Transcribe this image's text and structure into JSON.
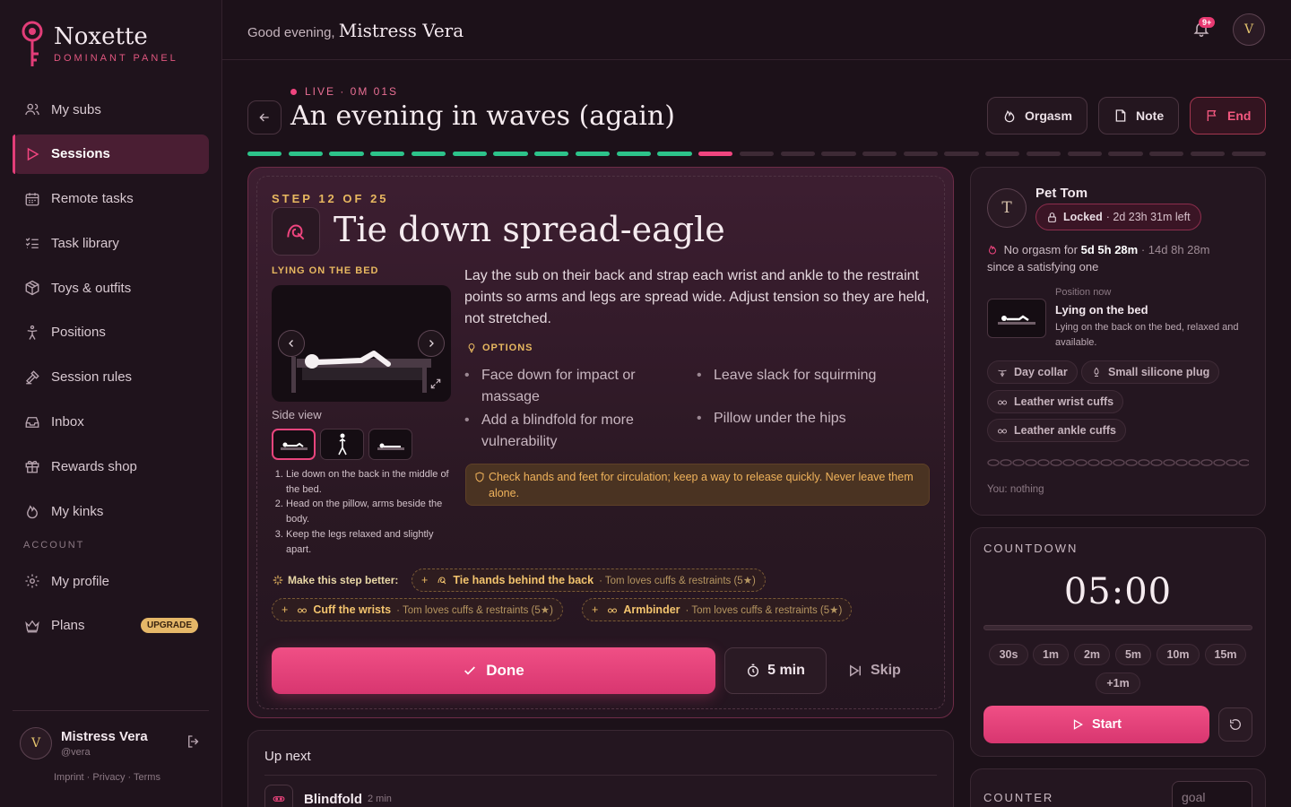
{
  "brand": {
    "name": "Noxette",
    "subtitle": "DOMINANT PANEL",
    "accent": "#e23d78"
  },
  "sidebar": {
    "items": [
      {
        "label": "My subs",
        "icon": "users-icon",
        "active": false
      },
      {
        "label": "Sessions",
        "icon": "play-icon",
        "active": true
      },
      {
        "label": "Remote tasks",
        "icon": "calendar-icon",
        "active": false
      },
      {
        "label": "Task library",
        "icon": "checklist-icon",
        "active": false
      },
      {
        "label": "Toys & outfits",
        "icon": "box-icon",
        "active": false
      },
      {
        "label": "Positions",
        "icon": "figure-icon",
        "active": false
      },
      {
        "label": "Session rules",
        "icon": "gavel-icon",
        "active": false
      },
      {
        "label": "Inbox",
        "icon": "inbox-icon",
        "active": false
      },
      {
        "label": "Rewards shop",
        "icon": "gift-icon",
        "active": false
      },
      {
        "label": "My kinks",
        "icon": "flame-icon",
        "active": false
      }
    ],
    "account_label": "ACCOUNT",
    "account_items": [
      {
        "label": "My profile",
        "icon": "gear-icon"
      },
      {
        "label": "Plans",
        "icon": "crown-icon",
        "badge": "UPGRADE"
      }
    ],
    "user": {
      "initial": "V",
      "name": "Mistress Vera",
      "handle": "@vera"
    },
    "legal": "Imprint · Privacy · Terms"
  },
  "topbar": {
    "greeting": "Good evening,",
    "name": "Mistress Vera",
    "notif_badge": "9+",
    "avatar_initial": "V"
  },
  "session": {
    "live_label": "LIVE · 0M 01S",
    "title": "An evening in waves (again)",
    "buttons": {
      "orgasm": "Orgasm",
      "note": "Note",
      "end": "End"
    },
    "total_steps": 25,
    "current_step": 12
  },
  "step": {
    "label": "STEP 12 OF 25",
    "title": "Tie down spread-eagle",
    "position_label": "LYING ON THE BED",
    "view_label": "Side view",
    "instructions": [
      "Lie down on the back in the middle of the bed.",
      "Head on the pillow, arms beside the body.",
      "Keep the legs relaxed and slightly apart."
    ],
    "description": "Lay the sub on their back and strap each wrist and ankle to the restraint points so arms and legs are spread wide. Adjust tension so they are held, not stretched.",
    "options_label": "OPTIONS",
    "options_left": [
      "Face down for impact or massage",
      "Add a blindfold for more vulnerability"
    ],
    "options_right": [
      "Leave slack for squirming",
      "Pillow under the hips"
    ],
    "warning": "Check hands and feet for circulation; keep a way to release quickly. Never leave them alone.",
    "better_label": "Make this step better:",
    "suggestions": [
      {
        "name": "Tie hands behind the back",
        "note": "· Tom loves cuffs & restraints (5★)"
      },
      {
        "name": "Cuff the wrists",
        "note": "· Tom loves cuffs & restraints (5★)"
      },
      {
        "name": "Armbinder",
        "note": "· Tom loves cuffs & restraints (5★)"
      }
    ],
    "done_label": "Done",
    "timer_label": "5 min",
    "skip_label": "Skip"
  },
  "up_next": {
    "title": "Up next",
    "items": [
      {
        "name": "Blindfold",
        "duration": "2 min"
      }
    ]
  },
  "sub": {
    "initial": "T",
    "name": "Pet Tom",
    "lock_status": "Locked",
    "lock_remaining": "· 2d 23h 31m left",
    "no_orgasm_prefix": "No orgasm for",
    "no_orgasm_value": "5d 5h 28m",
    "no_orgasm_dim": "· 14d 8h 28m",
    "no_orgasm_suffix": "since a satisfying one",
    "position_now_label": "Position now",
    "position_now_name": "Lying on the bed",
    "position_now_desc": "Lying on the back on the bed, relaxed and available.",
    "gear": [
      "Day collar",
      "Small silicone plug",
      "Leather wrist cuffs",
      "Leather ankle cuffs"
    ],
    "you_label": "You:",
    "you_value": "nothing"
  },
  "countdown": {
    "label": "COUNTDOWN",
    "time": "05:00",
    "presets": [
      "30s",
      "1m",
      "2m",
      "5m",
      "10m",
      "15m",
      "+1m"
    ],
    "start_label": "Start"
  },
  "counter": {
    "label": "COUNTER",
    "placeholder": "goal"
  }
}
